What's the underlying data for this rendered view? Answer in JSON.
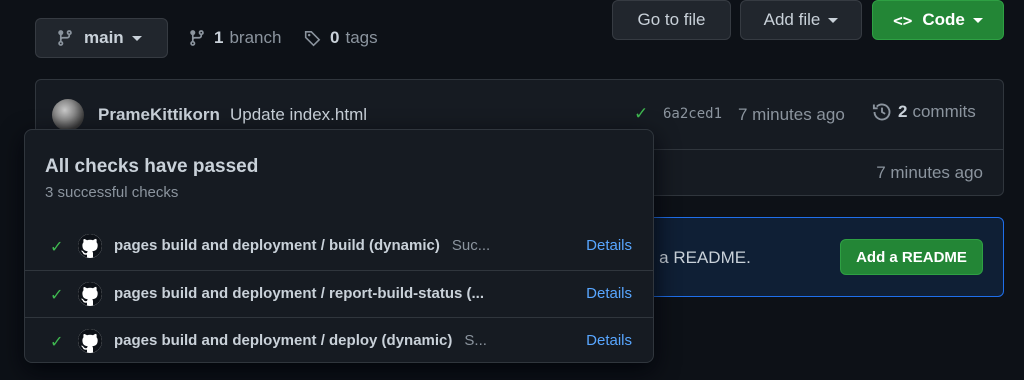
{
  "toolbar": {
    "branch_name": "main",
    "branch_count": "1",
    "branch_label": "branch",
    "tag_count": "0",
    "tag_label": "tags",
    "goto_file": "Go to file",
    "add_file": "Add file",
    "code_glyph": "<>",
    "code_label": "Code"
  },
  "latest_commit": {
    "author": "PrameKittikorn",
    "message": "Update index.html",
    "sha": "6a2ced1",
    "time": "7 minutes ago",
    "commits_count": "2",
    "commits_label": "commits",
    "status_icon": "check-icon"
  },
  "file_row": {
    "time": "7 minutes ago"
  },
  "readme_banner": {
    "text": "g a README.",
    "button": "Add a README",
    "accent": "#1f6feb"
  },
  "checks_popover": {
    "title": "All checks have passed",
    "subtitle": "3 successful checks",
    "items": [
      {
        "name": "pages build and deployment / build (dynamic)",
        "status": "Suc...",
        "details": "Details"
      },
      {
        "name": "pages build and deployment / report-build-status (...",
        "status": "",
        "details": "Details"
      },
      {
        "name": "pages build and deployment / deploy (dynamic)",
        "status": "S...",
        "details": "Details"
      }
    ]
  },
  "colors": {
    "background": "#0d1117",
    "success_green": "#3fb950",
    "primary_button": "#238636",
    "link_blue": "#58a6ff"
  }
}
